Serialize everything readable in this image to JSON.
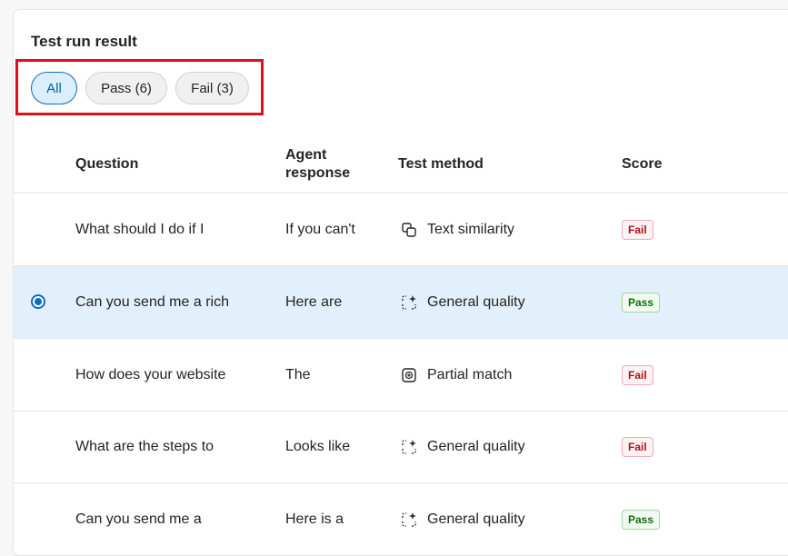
{
  "panel": {
    "title": "Test run result"
  },
  "filters": [
    {
      "label": "All",
      "active": true
    },
    {
      "label": "Pass (6)",
      "active": false
    },
    {
      "label": "Fail (3)",
      "active": false
    }
  ],
  "columns": {
    "question": "Question",
    "agent_response_line1": "Agent",
    "agent_response_line2": "response",
    "test_method": "Test method",
    "score": "Score"
  },
  "rows": [
    {
      "question": "What should I do if I",
      "response": "If you can't",
      "method": "Text similarity",
      "method_icon": "text-similarity-icon",
      "score": "Fail",
      "selected": false
    },
    {
      "question": "Can you send me a rich",
      "response": "Here are",
      "method": "General quality",
      "method_icon": "general-quality-icon",
      "score": "Pass",
      "selected": true
    },
    {
      "question": "How does your website",
      "response": "The",
      "method": "Partial match",
      "method_icon": "partial-match-icon",
      "score": "Fail",
      "selected": false
    },
    {
      "question": "What are the steps to",
      "response": "Looks like",
      "method": "General quality",
      "method_icon": "general-quality-icon",
      "score": "Fail",
      "selected": false
    },
    {
      "question": "Can you send me a",
      "response": "Here is a",
      "method": "General quality",
      "method_icon": "general-quality-icon",
      "score": "Pass",
      "selected": false
    }
  ],
  "colors": {
    "accent": "#0f6cbd",
    "selected_row": "#e1f0fa",
    "highlight": "#e0101a",
    "fail": "#b10e1c",
    "pass": "#0e700e"
  }
}
